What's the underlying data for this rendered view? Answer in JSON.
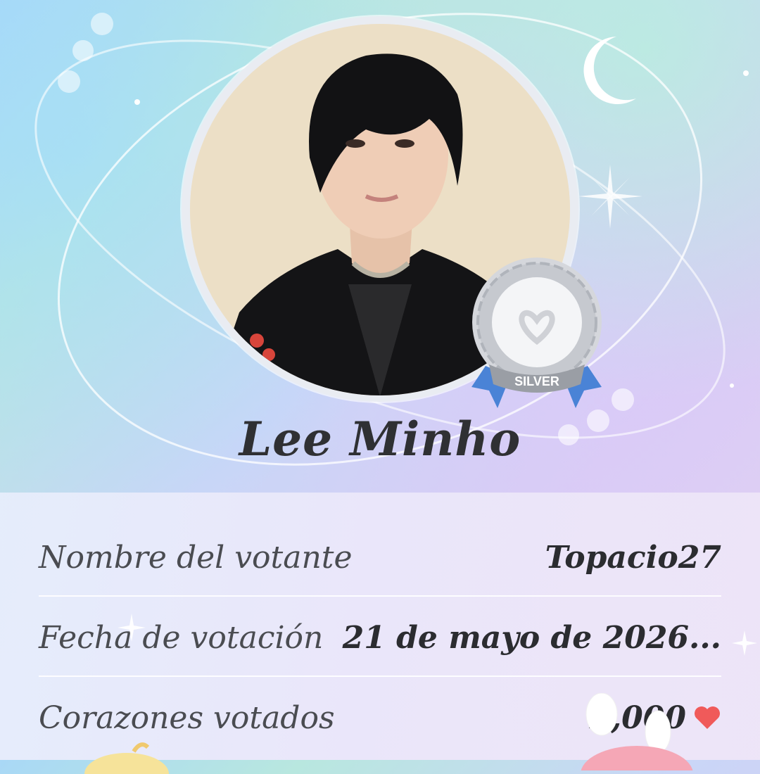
{
  "idol": {
    "name": "Lee Minho"
  },
  "badge": {
    "tier_label": "SILVER"
  },
  "vote_details": [
    {
      "label": "Nombre del votante",
      "value": "Topacio27"
    },
    {
      "label": "Fecha de votación",
      "value": "21 de mayo de 2026..."
    },
    {
      "label": "Corazones votados",
      "value": "2,000"
    }
  ],
  "icons": {
    "moon": "moon-icon",
    "sparkle": "sparkle-icon",
    "heart": "heart-icon",
    "badge": "silver-badge-icon"
  },
  "colors": {
    "heart": "#f05a5a",
    "text_dark": "#2f3033",
    "label": "#4a4c51",
    "ribbon": "#4a83d6",
    "silver": "#c9ccd2"
  }
}
